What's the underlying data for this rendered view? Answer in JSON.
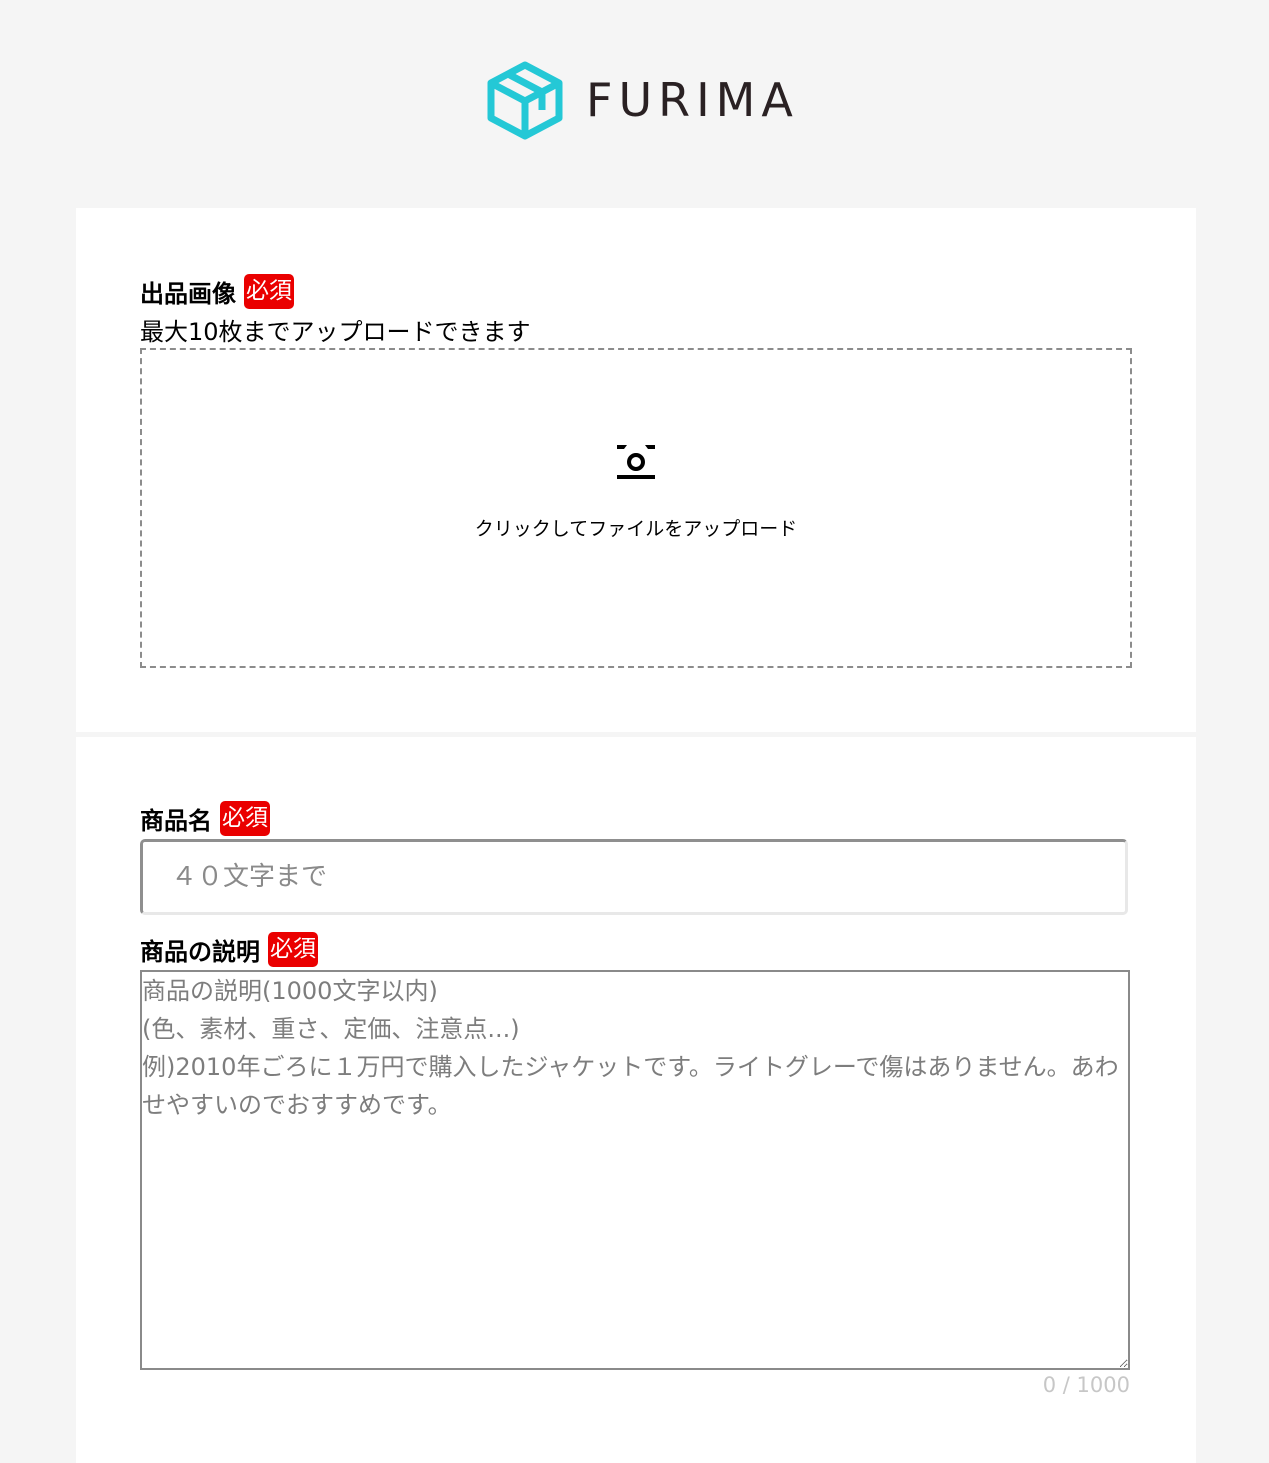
{
  "brand": {
    "name": "FURIMA",
    "accent_color": "#24c8d6"
  },
  "image_section": {
    "label": "出品画像",
    "required_badge": "必須",
    "note": "最大10枚までアップロードできます",
    "dropzone_icon": "camera-icon",
    "dropzone_text": "クリックしてファイルをアップロード"
  },
  "item_name": {
    "label": "商品名",
    "required_badge": "必須",
    "placeholder": "４０文字まで",
    "value": ""
  },
  "item_description": {
    "label": "商品の説明",
    "required_badge": "必須",
    "placeholder": "商品の説明(1000文字以内)\n(色、素材、重さ、定価、注意点...)\n例)2010年ごろに１万円で購入したジャケットです。ライトグレーで傷はありません。あわせやすいのでおすすめです。",
    "value": "",
    "counter": "0 / 1000"
  },
  "colors": {
    "required_badge": "#ea0000",
    "page_background": "#f5f5f5",
    "card_background": "#ffffff"
  }
}
